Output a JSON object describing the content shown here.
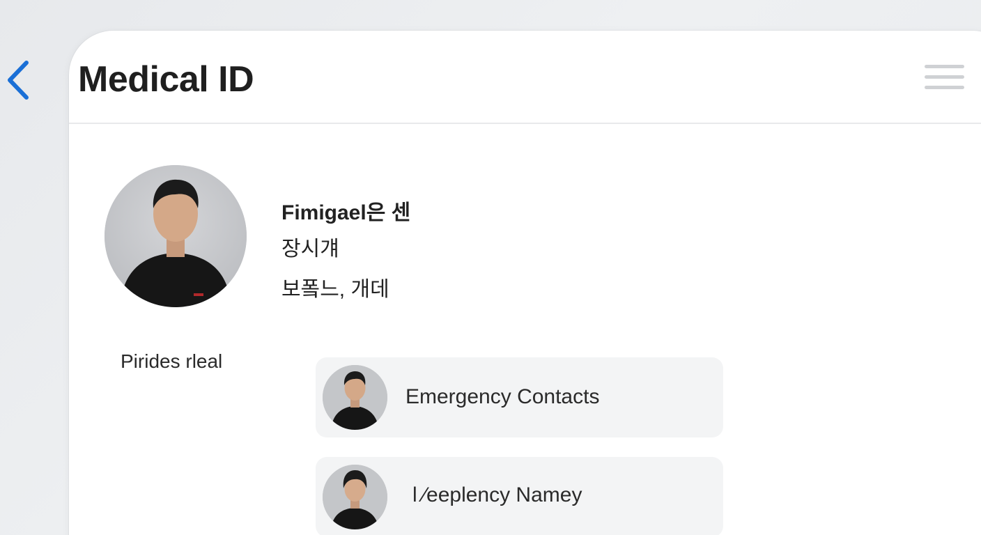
{
  "header": {
    "title": "Medical ID",
    "back_icon": "chevron-left-icon",
    "menu_icon": "hamburger-menu-icon"
  },
  "profile": {
    "name": "Fimigael은 센",
    "line2": "장시걔",
    "line3": "보퐄느, 개데"
  },
  "side_label": "Pirides rleal",
  "contacts": [
    {
      "label": "Emergency Contacts"
    },
    {
      "label": "l ⁄eeplency Namey"
    }
  ],
  "colors": {
    "accent": "#1a6fd6",
    "title": "#1f1f1f",
    "card_bg": "#ffffff",
    "row_bg": "#f3f4f5",
    "menu_lines": "#cfd1d4"
  }
}
